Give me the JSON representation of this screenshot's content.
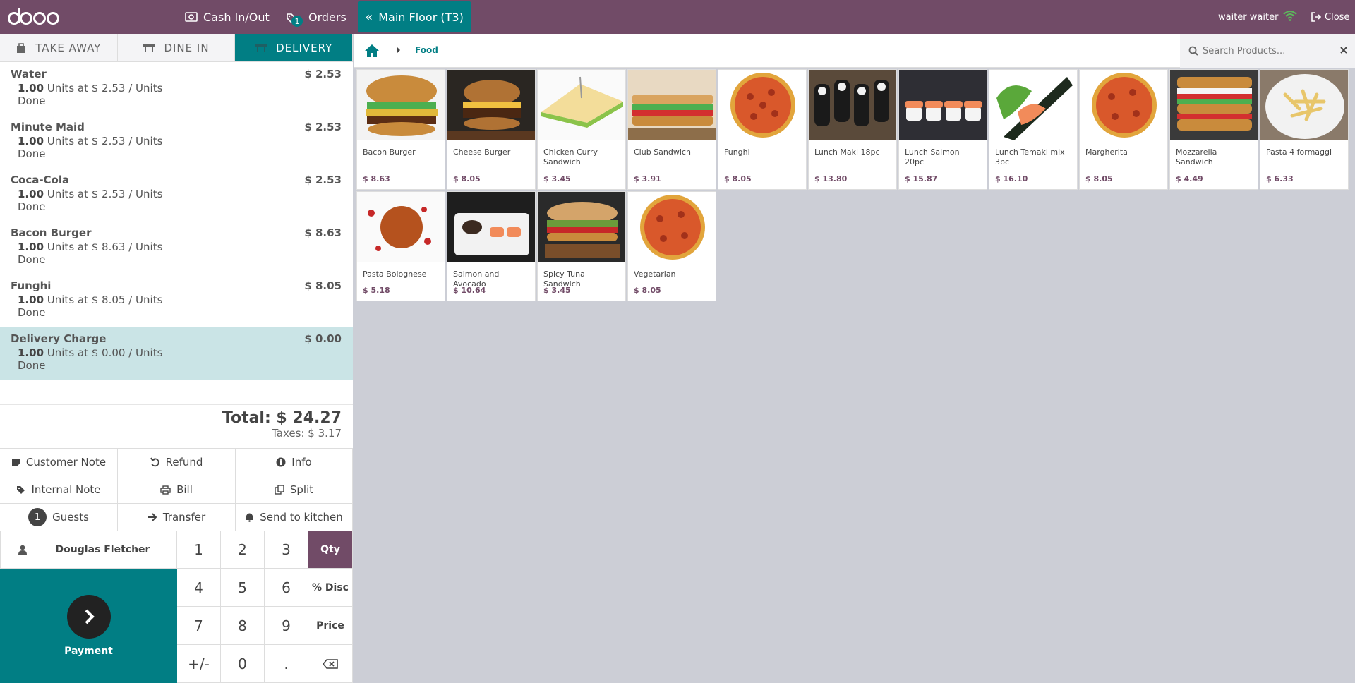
{
  "header": {
    "logo": "odoo",
    "cash_label": "Cash In/Out",
    "orders_label": "Orders",
    "orders_badge": "1",
    "floor_label": "Main Floor (T3)",
    "user": "waiter waiter",
    "close_label": "Close"
  },
  "modes": [
    "TAKE AWAY",
    "DINE IN",
    "DELIVERY"
  ],
  "order_lines": [
    {
      "name": "Water",
      "price": "$ 2.53",
      "qty": "1.00",
      "info": " Units at $ 2.53 / Units",
      "status": "Done"
    },
    {
      "name": "Minute Maid",
      "price": "$ 2.53",
      "qty": "1.00",
      "info": " Units at $ 2.53 / Units",
      "status": "Done"
    },
    {
      "name": "Coca-Cola",
      "price": "$ 2.53",
      "qty": "1.00",
      "info": " Units at $ 2.53 / Units",
      "status": "Done"
    },
    {
      "name": "Bacon Burger",
      "price": "$ 8.63",
      "qty": "1.00",
      "info": " Units at $ 8.63 / Units",
      "status": "Done"
    },
    {
      "name": "Funghi",
      "price": "$ 8.05",
      "qty": "1.00",
      "info": " Units at $ 8.05 / Units",
      "status": "Done"
    },
    {
      "name": "Delivery Charge",
      "price": "$ 0.00",
      "qty": "1.00",
      "info": " Units at $ 0.00 / Units",
      "status": "Done"
    }
  ],
  "totals": {
    "total": "Total: $ 24.27",
    "taxes": "Taxes: $ 3.17"
  },
  "controls": {
    "customer_note": "Customer Note",
    "refund": "Refund",
    "info": "Info",
    "internal_note": "Internal Note",
    "bill": "Bill",
    "split": "Split",
    "guests_count": "1",
    "guests": "Guests",
    "transfer": "Transfer",
    "send_to_kitchen": "Send to kitchen"
  },
  "customer": "Douglas Fletcher",
  "payment_label": "Payment",
  "numpad": {
    "k1": "1",
    "k2": "2",
    "k3": "3",
    "qty": "Qty",
    "k4": "4",
    "k5": "5",
    "k6": "6",
    "disc": "% Disc",
    "k7": "7",
    "k8": "8",
    "k9": "9",
    "price": "Price",
    "plusminus": "+/-",
    "k0": "0",
    "dot": "."
  },
  "breadcrumb": {
    "category": "Food"
  },
  "search": {
    "placeholder": "Search Products..."
  },
  "products": [
    {
      "name": "Bacon Burger",
      "price": "$ 8.63"
    },
    {
      "name": "Cheese Burger",
      "price": "$ 8.05"
    },
    {
      "name": "Chicken Curry Sandwich",
      "price": "$ 3.45"
    },
    {
      "name": "Club Sandwich",
      "price": "$ 3.91"
    },
    {
      "name": "Funghi",
      "price": "$ 8.05"
    },
    {
      "name": "Lunch Maki 18pc",
      "price": "$ 13.80"
    },
    {
      "name": "Lunch Salmon 20pc",
      "price": "$ 15.87"
    },
    {
      "name": "Lunch Temaki mix 3pc",
      "price": "$ 16.10"
    },
    {
      "name": "Margherita",
      "price": "$ 8.05"
    },
    {
      "name": "Mozzarella Sandwich",
      "price": "$ 4.49"
    },
    {
      "name": "Pasta 4 formaggi",
      "price": "$ 6.33"
    },
    {
      "name": "Pasta Bolognese",
      "price": "$ 5.18"
    },
    {
      "name": "Salmon and Avocado",
      "price": "$ 10.64"
    },
    {
      "name": "Spicy Tuna Sandwich",
      "price": "$ 3.45"
    },
    {
      "name": "Vegetarian",
      "price": "$ 8.05"
    }
  ],
  "colors": {
    "brand": "#714b67",
    "accent": "#017e84",
    "selected_line": "#cae4e6"
  }
}
